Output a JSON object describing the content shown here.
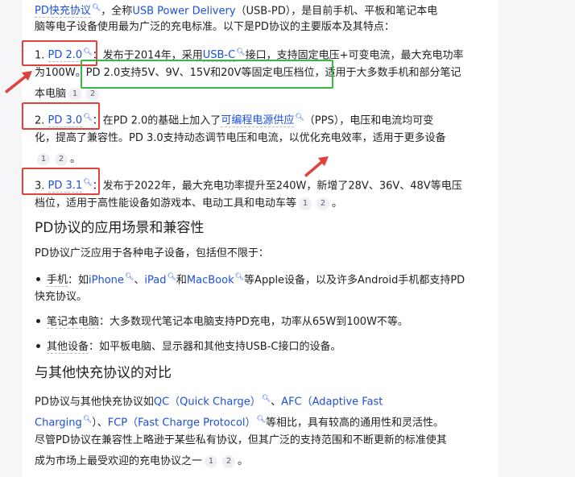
{
  "line1": {
    "term": "PD快充协议",
    "rest": "，全称",
    "usb": "USB Power Delivery",
    "paren": "（USB-PD），是目前手机、平板和笔记本电"
  },
  "line2": "脑等电子设备使用最为广泛的充电标准。以下是PD协议的主要版本及其特点：",
  "items": [
    {
      "index": "1.",
      "version": "PD 2.0",
      "l1_a": "：发布于2014年，采用",
      "l1_link": "USB-C",
      "l1_b": "接口，支持固定电压+可变电流，最大充电功率",
      "l2_a": "为100W。",
      "l2_hl": "PD 2.0支持5V、9V、15V和20V等固定电压档位",
      "l2_b": "，适用于大多数手机和部分笔记",
      "l3": "本电脑",
      "refs": [
        "1",
        "2"
      ]
    },
    {
      "index": "2.",
      "version": "PD 3.0",
      "l1_a": "：在PD 2.0的基础上加入了",
      "l1_link": "可编程电源供应",
      "l1_b": "（PPS），电压和电流均可变",
      "l2": "化，提高了兼容性。PD 3.0支持动态调节电压和电流，以优化充电效率，适用于更多设备",
      "refs": [
        "1",
        "2"
      ]
    },
    {
      "index": "3.",
      "version": "PD 3.1",
      "l1": "：发布于2022年，最大充电功率提升至240W，新增了28V、36V、48V等电压",
      "l2": "档位，适用于高性能设备如游戏本、电动工具和电动车等",
      "refs": [
        "1",
        "2"
      ]
    }
  ],
  "section1": {
    "heading": "PD协议的应用场景和兼容性",
    "intro": "PD协议广泛应用于各种电子设备，包括但不限于：",
    "b1": {
      "term": "手机",
      "a": "：如",
      "iphone": "iPhone",
      "sep1": "、",
      "ipad": "iPad",
      "and": "和",
      "macbook": "MacBook",
      "b": "等Apple设备，以及许多Android手机都支持PD",
      "l2": "快充协议。"
    },
    "b2": {
      "term": "笔记本电脑",
      "text": "：大多数现代笔记本电脑支持PD充电，功率从65W到100W不等。"
    },
    "b3": {
      "term": "其他设备",
      "text": "：如平板电脑、显示器和其他支持USB-C接口的设备。"
    }
  },
  "section2": {
    "heading": "与其他快充协议的对比",
    "l1_a": "PD协议与其他快充协议如",
    "qc": "QC（Quick Charge）",
    "sep": "、",
    "afc": "AFC（Adaptive Fast",
    "l2_a": "Charging",
    "l2_b": "）、",
    "fcp": "FCP（Fast Charge Protocol）",
    "l2_c": "等相比，具有较高的通用性和灵活性。",
    "l3": "尽管PD协议在兼容性上略逊于某些私有协议，但其广泛的支持范围和不断更新的标准使其",
    "l4": "成为市场上最受欢迎的充电协议之一",
    "refs": [
      "1",
      "2"
    ]
  },
  "colors": {
    "link": "#1d4fd8",
    "annotation_red": "#e2423d",
    "annotation_green": "#3ab54a"
  }
}
